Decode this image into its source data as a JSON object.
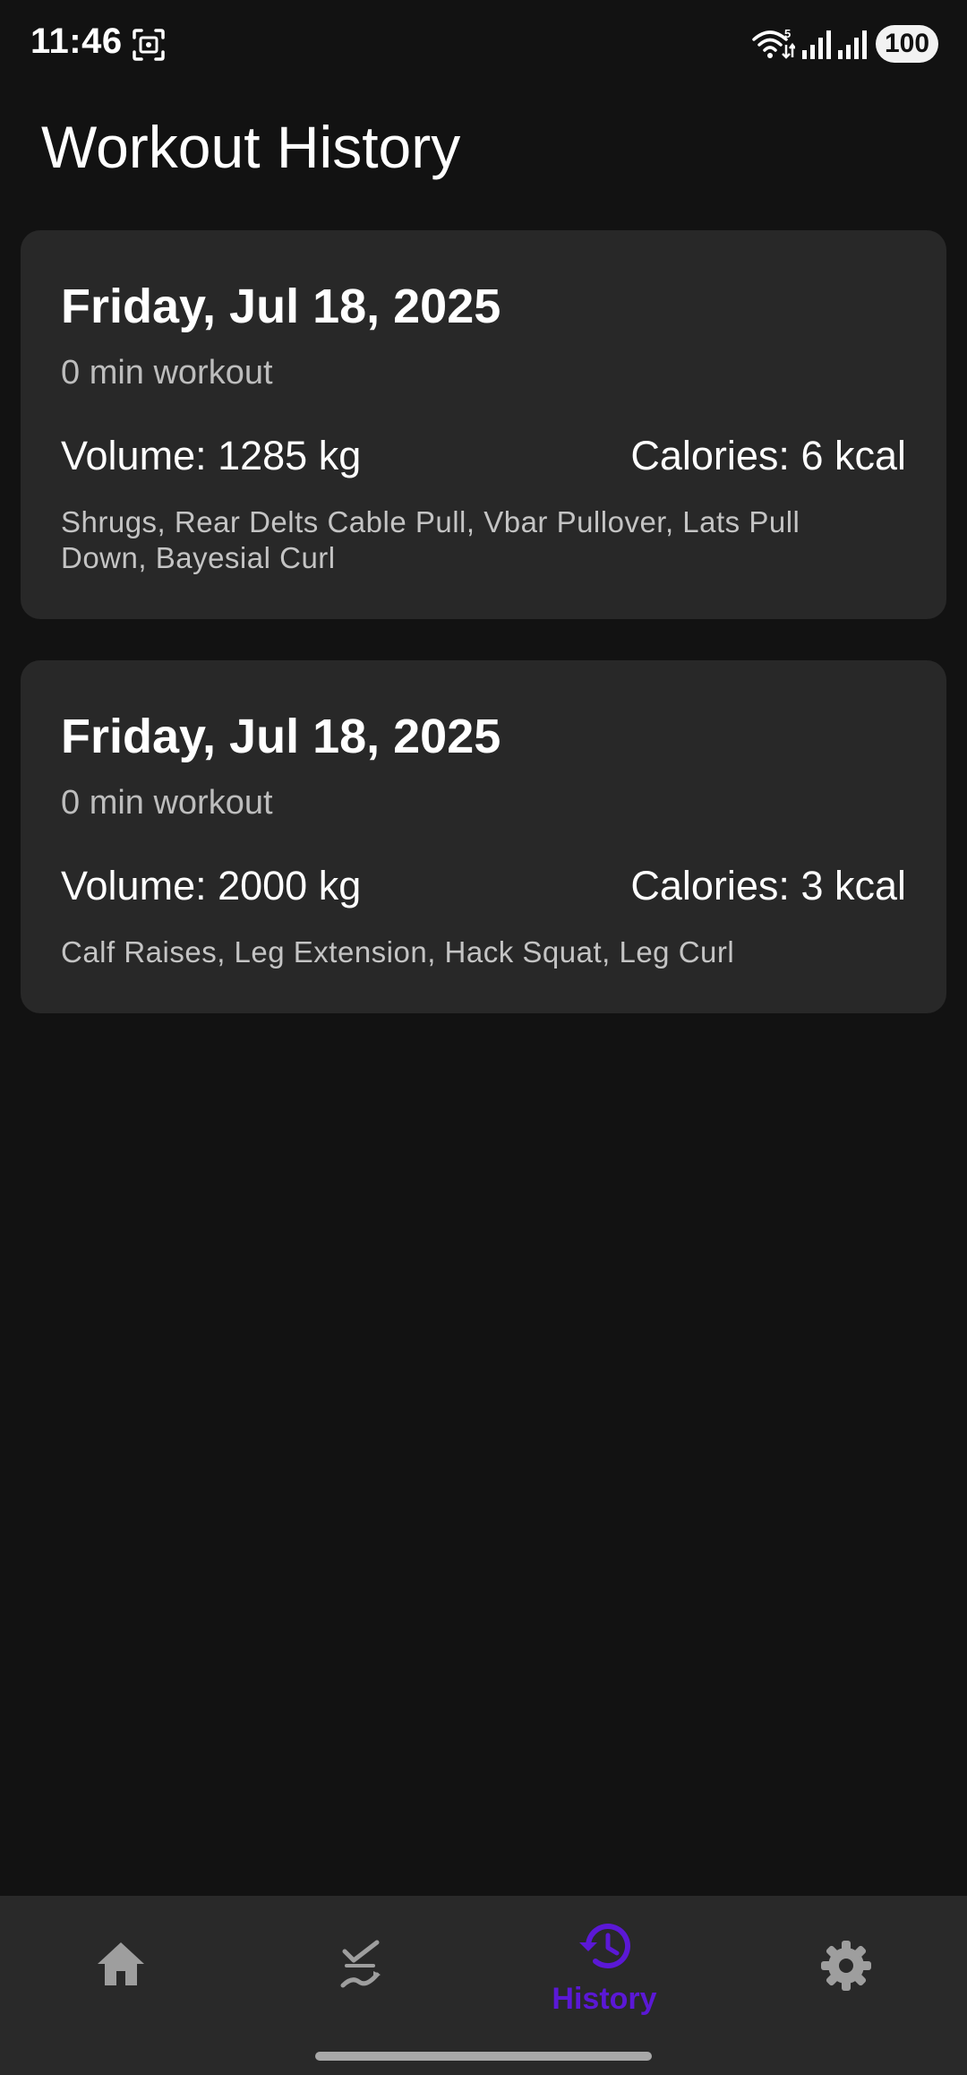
{
  "status_bar": {
    "time": "11:46",
    "battery": "100",
    "icons": [
      "screenshot-icon",
      "wifi-icon",
      "signal-icon",
      "signal-icon"
    ]
  },
  "page": {
    "title": "Workout History"
  },
  "workouts": [
    {
      "date": "Friday, Jul 18, 2025",
      "duration": "0 min workout",
      "volume": "Volume: 1285 kg",
      "calories": "Calories: 6 kcal",
      "exercises": "Shrugs, Rear Delts Cable Pull, Vbar Pullover, Lats Pull Down, Bayesial Curl"
    },
    {
      "date": "Friday, Jul 18, 2025",
      "duration": "0 min workout",
      "volume": "Volume: 2000 kg",
      "calories": "Calories: 3 kcal",
      "exercises": "Calf Raises, Leg Extension, Hack Squat, Leg Curl"
    }
  ],
  "nav": {
    "items": [
      {
        "icon": "home-icon",
        "label": ""
      },
      {
        "icon": "exercises-icon",
        "label": ""
      },
      {
        "icon": "history-icon",
        "label": "History",
        "active": true
      },
      {
        "icon": "settings-icon",
        "label": ""
      }
    ]
  },
  "colors": {
    "background": "#121212",
    "card": "#282828",
    "nav_background": "#292929",
    "accent": "#5b18d6",
    "inactive_icon": "#9e9e9e"
  }
}
